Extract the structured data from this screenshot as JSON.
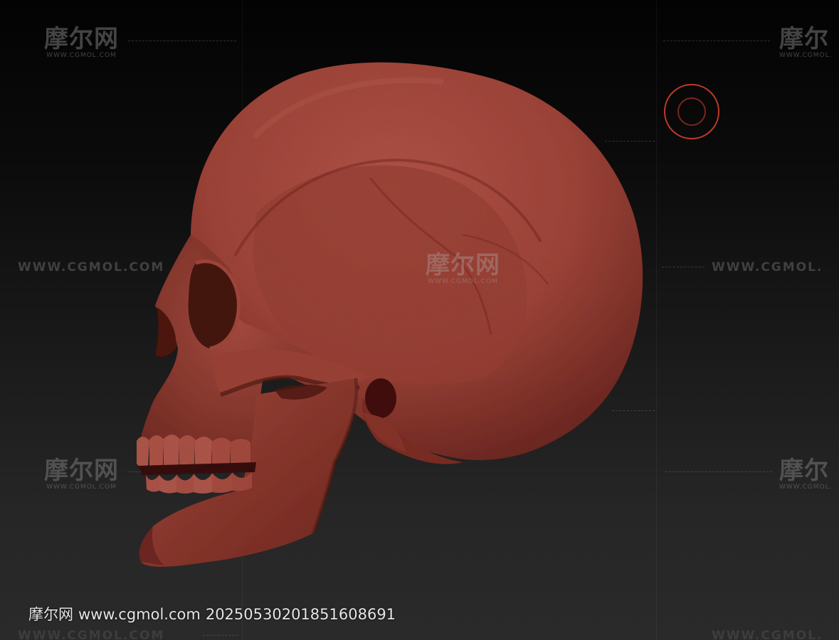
{
  "watermark": {
    "logo_cn": "摩尔网",
    "logo_en": "WWW.CGMOL.COM",
    "url": "WWW.CGMOL.COM",
    "url_partial": "WWW.CGMOL.",
    "logo_cn_partial": "摩尔",
    "logo_en_partial": "WWW.CGMOL.",
    "center_cn": "摩尔网",
    "center_en": "WWW.CGMOL.COM"
  },
  "footer_stamp": {
    "site_name": "摩尔网",
    "site_url": "www.cgmol.com",
    "id": "20250530201851608691"
  },
  "viewport": {
    "subject": "skull-model",
    "material_color": "#a8483a",
    "background_top": "#030303",
    "background_bottom": "#2a2a2a",
    "indicator_color": "#c0392b"
  }
}
